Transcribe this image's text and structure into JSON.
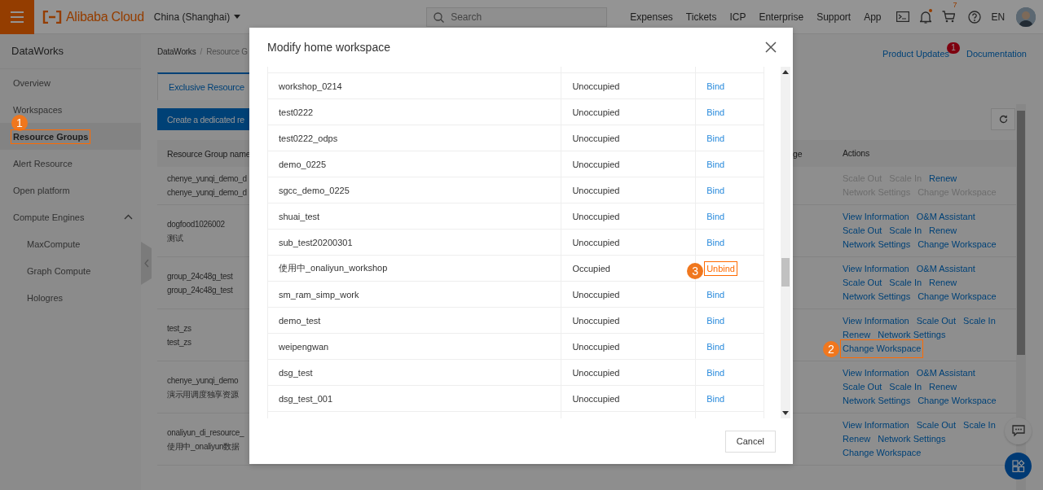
{
  "topbar": {
    "logo": "Alibaba Cloud",
    "region": "China (Shanghai)",
    "search": {
      "placeholder": "Search"
    },
    "links": [
      "Expenses",
      "Tickets",
      "ICP",
      "Enterprise",
      "Support",
      "App"
    ],
    "bell_unread": true,
    "cart_count": "7",
    "language": "EN"
  },
  "sidebar": {
    "title": "DataWorks",
    "items": [
      {
        "label": "Overview",
        "selected": false
      },
      {
        "label": "Workspaces",
        "selected": false
      },
      {
        "label": "Resource Groups",
        "selected": true,
        "callout": "1"
      },
      {
        "label": "Alert Resource",
        "selected": false
      },
      {
        "label": "Open platform",
        "selected": false
      },
      {
        "label": "Compute Engines",
        "selected": false,
        "expanded": true,
        "children": [
          {
            "label": "MaxCompute",
            "selected": false
          },
          {
            "label": "Graph Compute",
            "selected": false
          },
          {
            "label": "Hologres",
            "selected": false
          }
        ]
      }
    ]
  },
  "main": {
    "breadcrumb": {
      "items": [
        "DataWorks",
        "Resource G"
      ],
      "separator": "/"
    },
    "header_links": [
      {
        "label": "Product Updates",
        "badge": "1"
      },
      {
        "label": "Documentation"
      }
    ],
    "tabs": [
      {
        "label": "Exclusive Resource",
        "selected": true
      }
    ],
    "create_button": "Create a dedicated re",
    "table": {
      "columns": [
        "Resource Group name",
        "ge",
        "Actions"
      ],
      "rows": [
        {
          "names": [
            "chenye_yunqi_demo_d",
            "chenye_yunqi_demo_d"
          ],
          "action_lines": [
            [
              {
                "label": "Scale Out",
                "disabled": true
              },
              {
                "label": "Scale In",
                "disabled": true
              },
              {
                "label": "Renew",
                "disabled": false
              }
            ],
            [
              {
                "label": "Network Settings",
                "disabled": true
              },
              {
                "label": "Change Workspace",
                "disabled": true
              }
            ]
          ]
        },
        {
          "names": [
            "dogfood1026002",
            "测试"
          ],
          "action_lines": [
            [
              {
                "label": "View Information",
                "disabled": false
              },
              {
                "label": "O&M Assistant",
                "disabled": false
              }
            ],
            [
              {
                "label": "Scale Out",
                "disabled": false
              },
              {
                "label": "Scale In",
                "disabled": false
              },
              {
                "label": "Renew",
                "disabled": false
              }
            ],
            [
              {
                "label": "Network Settings",
                "disabled": false
              },
              {
                "label": "Change Workspace",
                "disabled": false
              }
            ]
          ]
        },
        {
          "names": [
            "group_24c48g_test",
            "group_24c48g_test"
          ],
          "action_lines": [
            [
              {
                "label": "View Information",
                "disabled": false
              },
              {
                "label": "O&M Assistant",
                "disabled": false
              }
            ],
            [
              {
                "label": "Scale Out",
                "disabled": false
              },
              {
                "label": "Scale In",
                "disabled": false
              },
              {
                "label": "Renew",
                "disabled": false
              }
            ],
            [
              {
                "label": "Network Settings",
                "disabled": false
              },
              {
                "label": "Change Workspace",
                "disabled": false
              }
            ]
          ]
        },
        {
          "names": [
            "test_zs",
            "test_zs"
          ],
          "action_lines": [
            [
              {
                "label": "View Information",
                "disabled": false
              },
              {
                "label": "Scale Out",
                "disabled": false
              },
              {
                "label": "Scale In",
                "disabled": false
              }
            ],
            [
              {
                "label": "Renew",
                "disabled": false
              },
              {
                "label": "Network Settings",
                "disabled": false
              }
            ],
            [
              {
                "label": "Change Workspace",
                "disabled": false,
                "callout": "2"
              }
            ]
          ]
        },
        {
          "names": [
            "chenye_yunqi_demo",
            "演示用调度独享资源"
          ],
          "action_lines": [
            [
              {
                "label": "View Information",
                "disabled": false
              },
              {
                "label": "O&M Assistant",
                "disabled": false
              }
            ],
            [
              {
                "label": "Scale Out",
                "disabled": false
              },
              {
                "label": "Scale In",
                "disabled": false
              },
              {
                "label": "Renew",
                "disabled": false
              }
            ],
            [
              {
                "label": "Network Settings",
                "disabled": false
              },
              {
                "label": "Change Workspace",
                "disabled": false
              }
            ]
          ]
        },
        {
          "names": [
            "onaliyun_di_resource_",
            "使用中_onaliyun数据"
          ],
          "action_lines": [
            [
              {
                "label": "View Information",
                "disabled": false
              },
              {
                "label": "Scale Out",
                "disabled": false
              },
              {
                "label": "Scale In",
                "disabled": false
              }
            ],
            [
              {
                "label": "Renew",
                "disabled": false
              },
              {
                "label": "Network Settings",
                "disabled": false
              }
            ],
            [
              {
                "label": "Change Workspace",
                "disabled": false
              }
            ]
          ]
        }
      ]
    }
  },
  "modal": {
    "title": "Modify home workspace",
    "rows": [
      {
        "workspace": "workshop_0214",
        "status": "Unoccupied",
        "action": "Bind",
        "kind": "bind"
      },
      {
        "workspace": "test0222",
        "status": "Unoccupied",
        "action": "Bind",
        "kind": "bind"
      },
      {
        "workspace": "test0222_odps",
        "status": "Unoccupied",
        "action": "Bind",
        "kind": "bind"
      },
      {
        "workspace": "demo_0225",
        "status": "Unoccupied",
        "action": "Bind",
        "kind": "bind"
      },
      {
        "workspace": "sgcc_demo_0225",
        "status": "Unoccupied",
        "action": "Bind",
        "kind": "bind"
      },
      {
        "workspace": "shuai_test",
        "status": "Unoccupied",
        "action": "Bind",
        "kind": "bind"
      },
      {
        "workspace": "sub_test20200301",
        "status": "Unoccupied",
        "action": "Bind",
        "kind": "bind"
      },
      {
        "workspace": "使用中_onaliyun_workshop",
        "status": "Occupied",
        "action": "Unbind",
        "kind": "unbind",
        "callout": "3"
      },
      {
        "workspace": "sm_ram_simp_work",
        "status": "Unoccupied",
        "action": "Bind",
        "kind": "bind"
      },
      {
        "workspace": "demo_test",
        "status": "Unoccupied",
        "action": "Bind",
        "kind": "bind"
      },
      {
        "workspace": "weipengwan",
        "status": "Unoccupied",
        "action": "Bind",
        "kind": "bind"
      },
      {
        "workspace": "dsg_test",
        "status": "Unoccupied",
        "action": "Bind",
        "kind": "bind"
      },
      {
        "workspace": "dsg_test_001",
        "status": "Unoccupied",
        "action": "Bind",
        "kind": "bind"
      }
    ],
    "buttons": [
      "Cancel"
    ]
  }
}
